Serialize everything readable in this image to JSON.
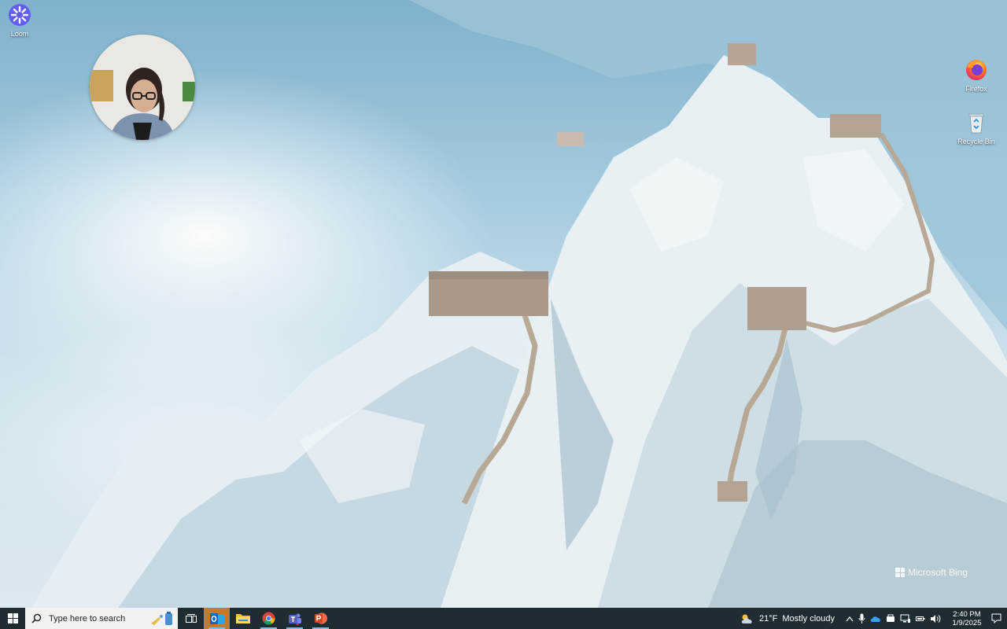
{
  "desktop": {
    "icons": [
      {
        "label": "Loom"
      },
      {
        "label": "Firefox"
      },
      {
        "label": "Recycle Bin"
      }
    ],
    "watermark": "Microsoft Bing"
  },
  "taskbar": {
    "search_placeholder": "Type here to search",
    "pinned_apps": [
      "start-icon",
      "task-view-icon",
      "outlook-icon",
      "file-explorer-icon",
      "chrome-icon",
      "teams-icon",
      "powerpoint-icon"
    ],
    "weather": {
      "temperature": "21°F",
      "condition": "Mostly cloudy"
    },
    "clock": {
      "time": "2:40 PM",
      "date": "1/9/2025"
    }
  },
  "colors": {
    "taskbar_bg": "#1f2d33",
    "accent": "#86b8e0",
    "outlook": "#0a64c0",
    "powerpoint": "#d24726",
    "teams": "#5b5fc7"
  }
}
